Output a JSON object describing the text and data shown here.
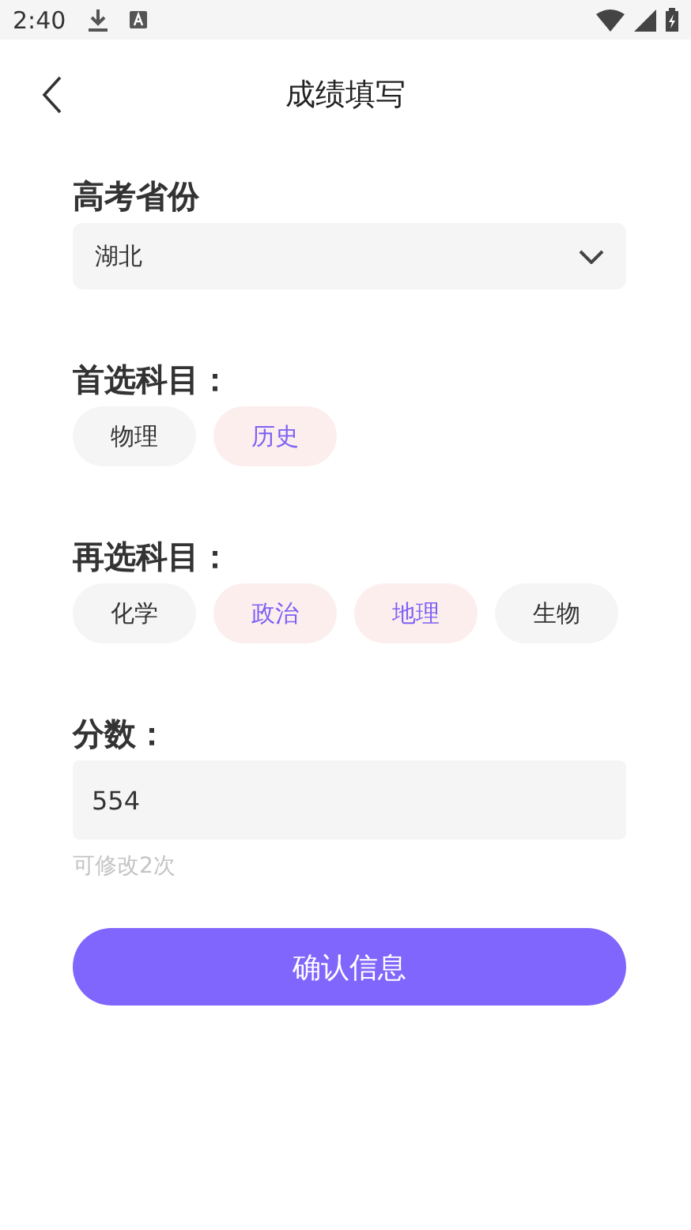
{
  "status_bar": {
    "time": "2:40"
  },
  "header": {
    "title": "成绩填写"
  },
  "province": {
    "label": "高考省份",
    "value": "湖北"
  },
  "first_subjects": {
    "label": "首选科目：",
    "options": [
      {
        "label": "物理",
        "selected": false
      },
      {
        "label": "历史",
        "selected": true
      }
    ]
  },
  "second_subjects": {
    "label": "再选科目：",
    "options": [
      {
        "label": "化学",
        "selected": false
      },
      {
        "label": "政治",
        "selected": true
      },
      {
        "label": "地理",
        "selected": true
      },
      {
        "label": "生物",
        "selected": false
      }
    ]
  },
  "score": {
    "label": "分数：",
    "value": "554",
    "hint": "可修改2次"
  },
  "confirm_button": {
    "label": "确认信息"
  }
}
